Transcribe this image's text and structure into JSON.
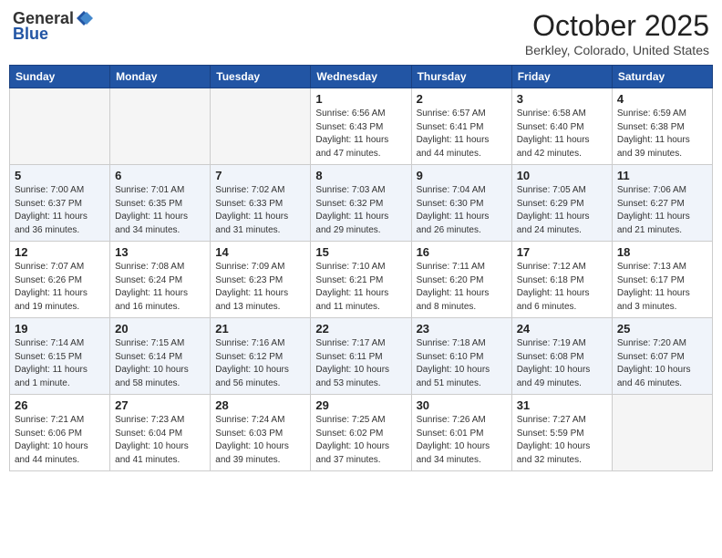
{
  "header": {
    "logo_general": "General",
    "logo_blue": "Blue",
    "month_title": "October 2025",
    "location": "Berkley, Colorado, United States"
  },
  "weekdays": [
    "Sunday",
    "Monday",
    "Tuesday",
    "Wednesday",
    "Thursday",
    "Friday",
    "Saturday"
  ],
  "weeks": [
    [
      {
        "day": "",
        "info": ""
      },
      {
        "day": "",
        "info": ""
      },
      {
        "day": "",
        "info": ""
      },
      {
        "day": "1",
        "info": "Sunrise: 6:56 AM\nSunset: 6:43 PM\nDaylight: 11 hours and 47 minutes."
      },
      {
        "day": "2",
        "info": "Sunrise: 6:57 AM\nSunset: 6:41 PM\nDaylight: 11 hours and 44 minutes."
      },
      {
        "day": "3",
        "info": "Sunrise: 6:58 AM\nSunset: 6:40 PM\nDaylight: 11 hours and 42 minutes."
      },
      {
        "day": "4",
        "info": "Sunrise: 6:59 AM\nSunset: 6:38 PM\nDaylight: 11 hours and 39 minutes."
      }
    ],
    [
      {
        "day": "5",
        "info": "Sunrise: 7:00 AM\nSunset: 6:37 PM\nDaylight: 11 hours and 36 minutes."
      },
      {
        "day": "6",
        "info": "Sunrise: 7:01 AM\nSunset: 6:35 PM\nDaylight: 11 hours and 34 minutes."
      },
      {
        "day": "7",
        "info": "Sunrise: 7:02 AM\nSunset: 6:33 PM\nDaylight: 11 hours and 31 minutes."
      },
      {
        "day": "8",
        "info": "Sunrise: 7:03 AM\nSunset: 6:32 PM\nDaylight: 11 hours and 29 minutes."
      },
      {
        "day": "9",
        "info": "Sunrise: 7:04 AM\nSunset: 6:30 PM\nDaylight: 11 hours and 26 minutes."
      },
      {
        "day": "10",
        "info": "Sunrise: 7:05 AM\nSunset: 6:29 PM\nDaylight: 11 hours and 24 minutes."
      },
      {
        "day": "11",
        "info": "Sunrise: 7:06 AM\nSunset: 6:27 PM\nDaylight: 11 hours and 21 minutes."
      }
    ],
    [
      {
        "day": "12",
        "info": "Sunrise: 7:07 AM\nSunset: 6:26 PM\nDaylight: 11 hours and 19 minutes."
      },
      {
        "day": "13",
        "info": "Sunrise: 7:08 AM\nSunset: 6:24 PM\nDaylight: 11 hours and 16 minutes."
      },
      {
        "day": "14",
        "info": "Sunrise: 7:09 AM\nSunset: 6:23 PM\nDaylight: 11 hours and 13 minutes."
      },
      {
        "day": "15",
        "info": "Sunrise: 7:10 AM\nSunset: 6:21 PM\nDaylight: 11 hours and 11 minutes."
      },
      {
        "day": "16",
        "info": "Sunrise: 7:11 AM\nSunset: 6:20 PM\nDaylight: 11 hours and 8 minutes."
      },
      {
        "day": "17",
        "info": "Sunrise: 7:12 AM\nSunset: 6:18 PM\nDaylight: 11 hours and 6 minutes."
      },
      {
        "day": "18",
        "info": "Sunrise: 7:13 AM\nSunset: 6:17 PM\nDaylight: 11 hours and 3 minutes."
      }
    ],
    [
      {
        "day": "19",
        "info": "Sunrise: 7:14 AM\nSunset: 6:15 PM\nDaylight: 11 hours and 1 minute."
      },
      {
        "day": "20",
        "info": "Sunrise: 7:15 AM\nSunset: 6:14 PM\nDaylight: 10 hours and 58 minutes."
      },
      {
        "day": "21",
        "info": "Sunrise: 7:16 AM\nSunset: 6:12 PM\nDaylight: 10 hours and 56 minutes."
      },
      {
        "day": "22",
        "info": "Sunrise: 7:17 AM\nSunset: 6:11 PM\nDaylight: 10 hours and 53 minutes."
      },
      {
        "day": "23",
        "info": "Sunrise: 7:18 AM\nSunset: 6:10 PM\nDaylight: 10 hours and 51 minutes."
      },
      {
        "day": "24",
        "info": "Sunrise: 7:19 AM\nSunset: 6:08 PM\nDaylight: 10 hours and 49 minutes."
      },
      {
        "day": "25",
        "info": "Sunrise: 7:20 AM\nSunset: 6:07 PM\nDaylight: 10 hours and 46 minutes."
      }
    ],
    [
      {
        "day": "26",
        "info": "Sunrise: 7:21 AM\nSunset: 6:06 PM\nDaylight: 10 hours and 44 minutes."
      },
      {
        "day": "27",
        "info": "Sunrise: 7:23 AM\nSunset: 6:04 PM\nDaylight: 10 hours and 41 minutes."
      },
      {
        "day": "28",
        "info": "Sunrise: 7:24 AM\nSunset: 6:03 PM\nDaylight: 10 hours and 39 minutes."
      },
      {
        "day": "29",
        "info": "Sunrise: 7:25 AM\nSunset: 6:02 PM\nDaylight: 10 hours and 37 minutes."
      },
      {
        "day": "30",
        "info": "Sunrise: 7:26 AM\nSunset: 6:01 PM\nDaylight: 10 hours and 34 minutes."
      },
      {
        "day": "31",
        "info": "Sunrise: 7:27 AM\nSunset: 5:59 PM\nDaylight: 10 hours and 32 minutes."
      },
      {
        "day": "",
        "info": ""
      }
    ]
  ]
}
